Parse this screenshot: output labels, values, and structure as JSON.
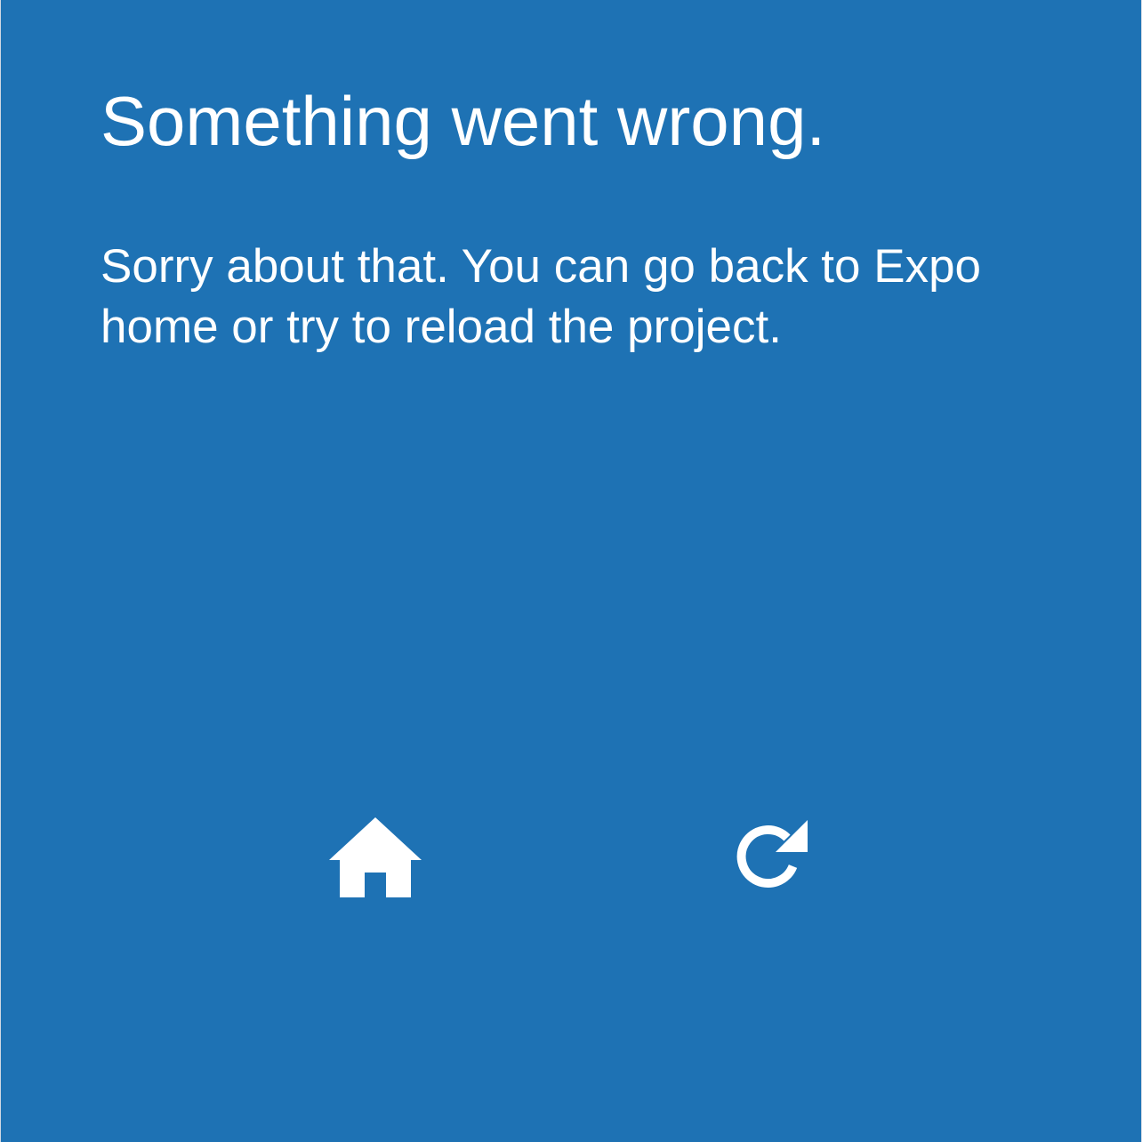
{
  "theme": {
    "background": "#1E72B4",
    "text": "#FFFFFF"
  },
  "error": {
    "title": "Something went wrong.",
    "message": "Sorry about that. You can go back to Expo home or try to reload the project."
  },
  "actions": {
    "home": {
      "icon": "home-icon"
    },
    "reload": {
      "icon": "reload-icon"
    }
  }
}
